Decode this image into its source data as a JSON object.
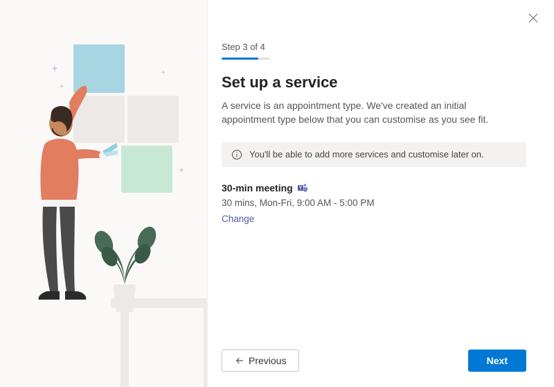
{
  "step": {
    "label": "Step 3 of 4"
  },
  "heading": "Set up a service",
  "description": "A service is an appointment type. We've created an initial appointment type below that you can customise as you see fit.",
  "info_banner": "You'll be able to add more services and customise later on.",
  "service": {
    "name": "30-min meeting",
    "detail": "30 mins, Mon-Fri, 9:00 AM - 5:00 PM",
    "change_label": "Change"
  },
  "footer": {
    "previous_label": "Previous",
    "next_label": "Next"
  }
}
